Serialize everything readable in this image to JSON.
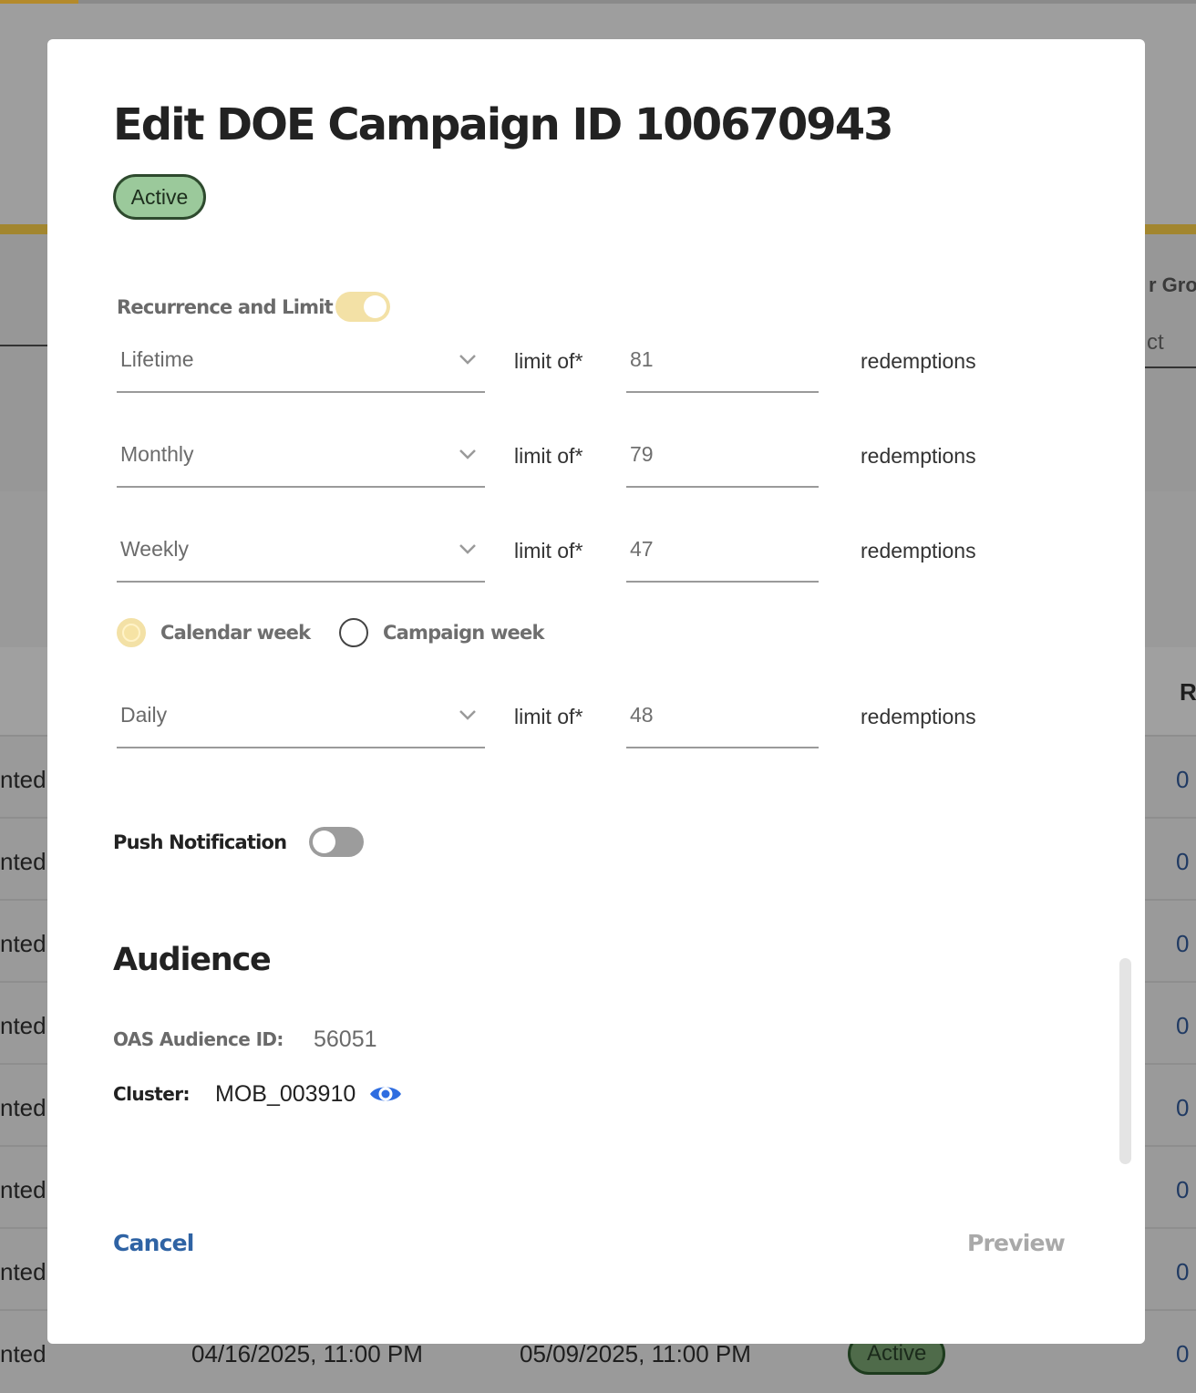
{
  "background": {
    "header_fragment": "r Grou",
    "select_fragment": "ct",
    "column_fragment": "R",
    "row_status_fragment": "nted",
    "row_value_fragment": "0",
    "last_row": {
      "status": "nted",
      "start": "04/16/2025, 11:00 PM",
      "end": "05/09/2025, 11:00 PM",
      "badge": "Active",
      "value": "0"
    }
  },
  "modal": {
    "title": "Edit DOE Campaign ID 100670943",
    "status": "Active",
    "recurrence": {
      "label": "Recurrence and Limit",
      "enabled": true,
      "limit_label": "limit of*",
      "unit_label": "redemptions",
      "rows": [
        {
          "period": "Lifetime",
          "limit": "81"
        },
        {
          "period": "Monthly",
          "limit": "79"
        },
        {
          "period": "Weekly",
          "limit": "47"
        },
        {
          "period": "Daily",
          "limit": "48"
        }
      ],
      "week_options": [
        {
          "label": "Calendar week",
          "selected": true
        },
        {
          "label": "Campaign week",
          "selected": false
        }
      ]
    },
    "push_notification": {
      "label": "Push Notification",
      "enabled": false
    },
    "audience": {
      "title": "Audience",
      "oas_label": "OAS Audience ID:",
      "oas_value": "56051",
      "cluster_label": "Cluster:",
      "cluster_value": "MOB_003910"
    },
    "actions": {
      "cancel": "Cancel",
      "preview": "Preview"
    }
  },
  "colors": {
    "toggle_on": "#f3e1a6",
    "badge_bg": "#9bc99b",
    "link_blue": "#2f63a4",
    "eye_icon": "#2f6de0"
  }
}
